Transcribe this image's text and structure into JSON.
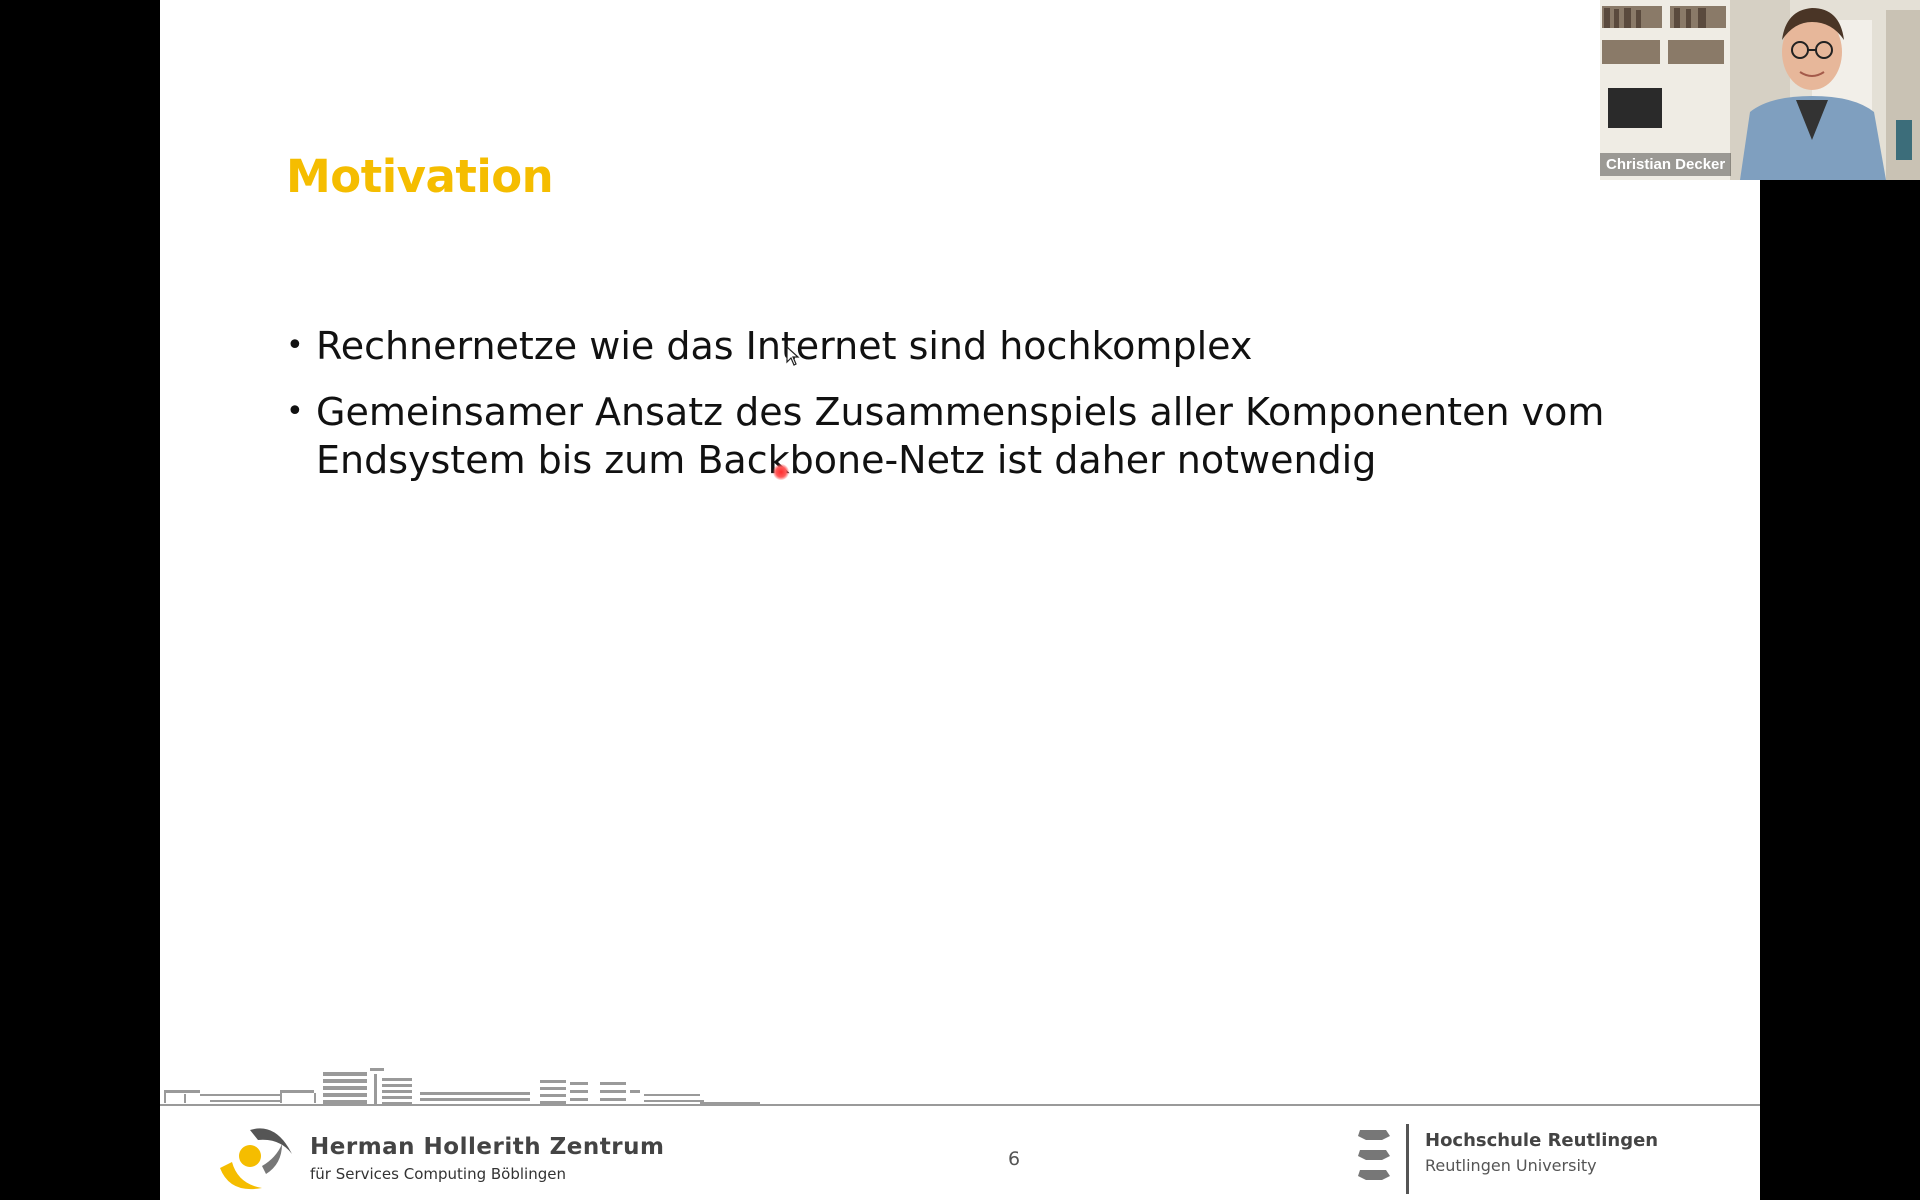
{
  "slide": {
    "title": "Motivation",
    "bullets": [
      "Rechnernetze wie das Internet sind hochkomplex",
      "Gemeinsamer Ansatz des Zusammenspiels aller Komponenten vom Endsystem bis zum Backbone-Netz ist daher notwendig"
    ],
    "bullet_symbol": "•",
    "page_number": "6",
    "title_color": "#f5bd00"
  },
  "footer": {
    "left_logo": {
      "name": "Herman Hollerith Zentrum",
      "subtitle": "für Services Computing Böblingen"
    },
    "right_logo": {
      "name": "Hochschule Reutlingen",
      "subtitle": "Reutlingen University"
    }
  },
  "video": {
    "participant_name": "Christian Decker"
  },
  "colors": {
    "accent_yellow": "#f5bd00",
    "laser_pointer": "#ff2d2d"
  }
}
